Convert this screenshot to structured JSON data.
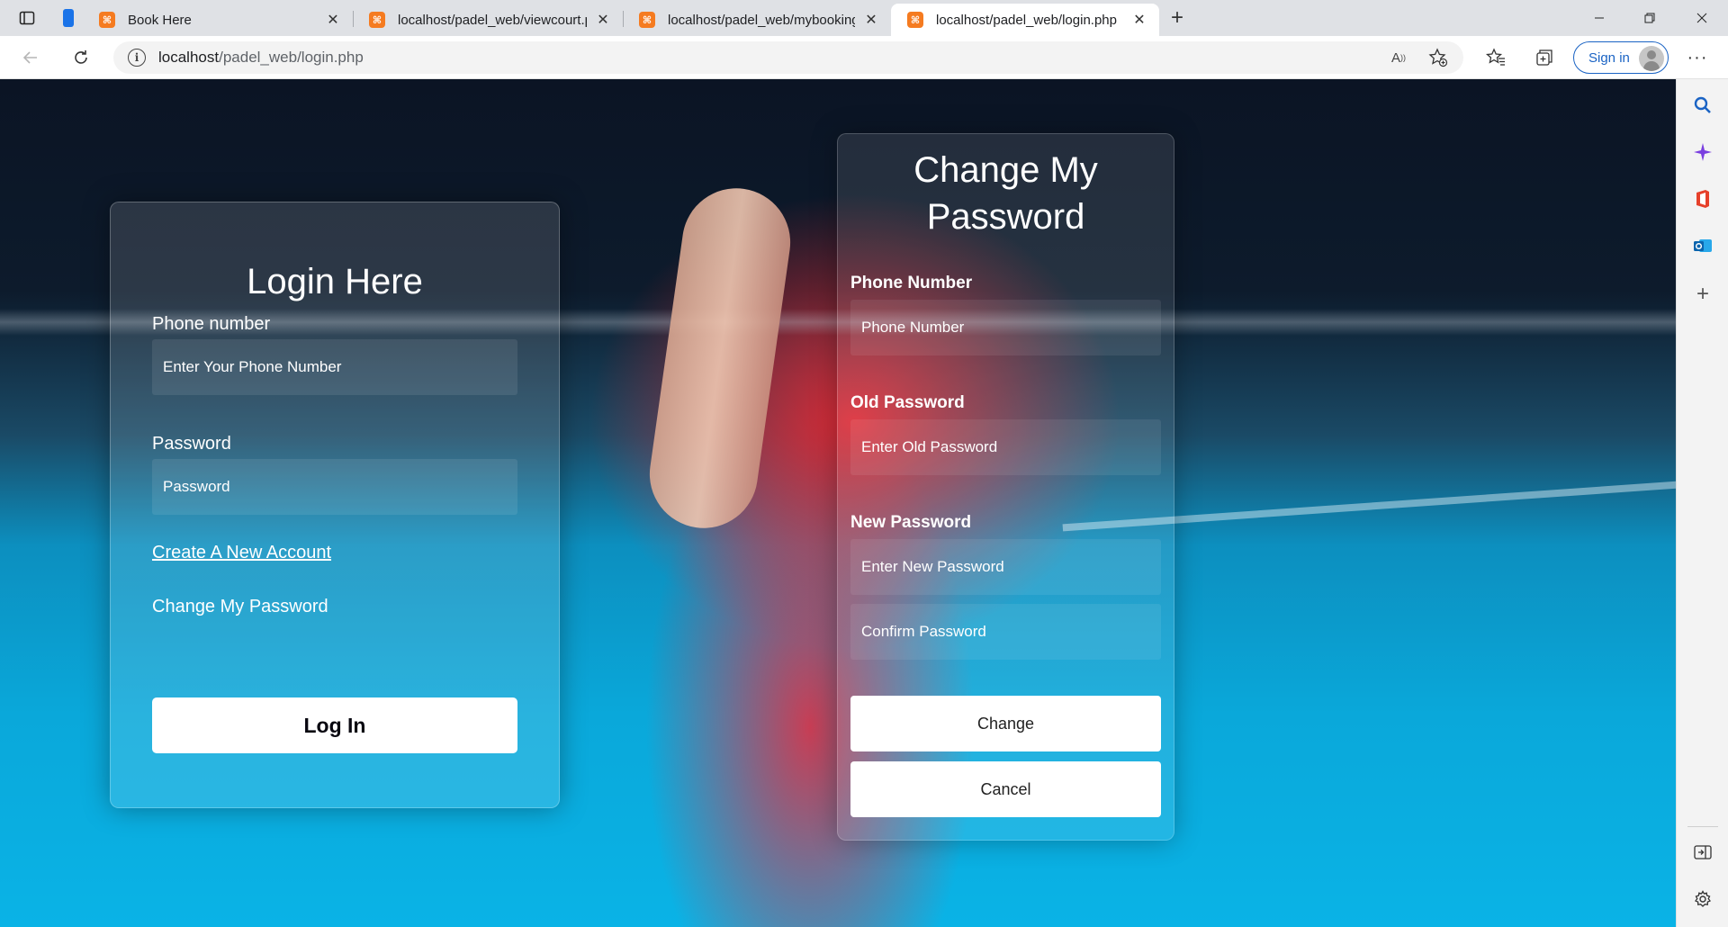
{
  "browser": {
    "tabs": [
      {
        "title": "Book Here",
        "active": false
      },
      {
        "title": "localhost/padel_web/viewcourt.p",
        "active": false
      },
      {
        "title": "localhost/padel_web/mybooking",
        "active": false
      },
      {
        "title": "localhost/padel_web/login.php",
        "active": true
      }
    ],
    "address": {
      "host": "localhost",
      "path": "/padel_web/login.php"
    },
    "signin_label": "Sign in"
  },
  "login": {
    "title": "Login Here",
    "phone_label": "Phone number",
    "phone_placeholder": "Enter Your Phone Number",
    "password_label": "Password",
    "password_placeholder": "Password",
    "create_account_link": "Create A New Account",
    "change_password_link": "Change My Password",
    "login_button": "Log In"
  },
  "change_password": {
    "title_line1": "Change My",
    "title_line2": "Password",
    "phone_label": "Phone Number",
    "phone_placeholder": "Phone Number",
    "old_password_label": "Old Password",
    "old_password_placeholder": "Enter Old Password",
    "new_password_label": "New Password",
    "new_password_placeholder": "Enter New Password",
    "confirm_password_placeholder": "Confirm Password",
    "change_button": "Change",
    "cancel_button": "Cancel"
  },
  "colors": {
    "accent": "#1a63c4",
    "favicon": "#f57b20",
    "court_blue": "#0aa8da",
    "shirt_red": "#e62832"
  }
}
